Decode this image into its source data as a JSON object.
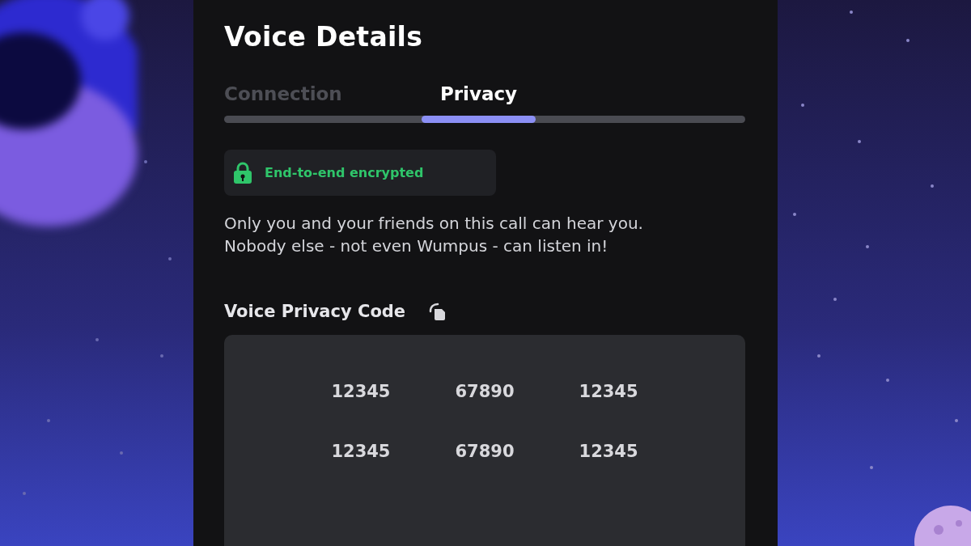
{
  "title": "Voice Details",
  "tabs": [
    {
      "label": "Connection",
      "selected": false
    },
    {
      "label": "Privacy",
      "selected": true
    }
  ],
  "badge": {
    "label": "End-to-end encrypted"
  },
  "description": "Only you and your friends on this call can hear you. Nobody else - not even Wumpus - can listen in!",
  "code_section": {
    "heading": "Voice Privacy Code",
    "codes": [
      "12345",
      "67890",
      "12345",
      "12345",
      "67890",
      "12345"
    ]
  }
}
